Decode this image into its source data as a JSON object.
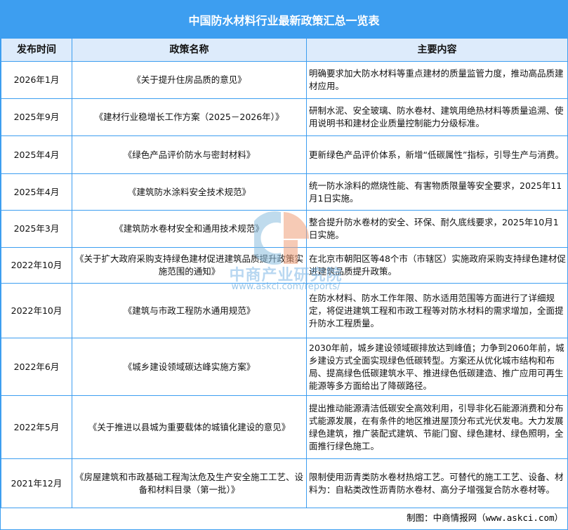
{
  "title": "中国防水材料行业最新政策汇总一览表",
  "headers": [
    "发布时间",
    "政策名称",
    "主要内容"
  ],
  "rows": [
    {
      "date": "2026年1月",
      "name": "《关于提升住房品质的意见》",
      "content": "明确要求加大防水材料等重点建材的质量监管力度，推动高品质建材应用。"
    },
    {
      "date": "2025年9月",
      "name": "《建材行业稳增长工作方案（2025－2026年）》",
      "content": "研制水泥、安全玻璃、防水卷材、建筑用绝热材料等质量追溯、使用说明书和建材企业质量控制能力分级标准。"
    },
    {
      "date": "2025年4月",
      "name": "《绿色产品评价防水与密封材料》",
      "content": "更新绿色产品评价体系，新增“低碳属性”指标，引导生产与消费。"
    },
    {
      "date": "2025年4月",
      "name": "《建筑防水涂料安全技术规范》",
      "content": "统一防水涂料的燃烧性能、有害物质限量等安全要求，2025年11月1日实施。"
    },
    {
      "date": "2025年3月",
      "name": "《建筑防水卷材安全和通用技术规范》",
      "content": "整合提升防水卷材的安全、环保、耐久底线要求，2025年10月1日实施。"
    },
    {
      "date": "2022年10月",
      "name": "《关于扩大政府采购支持绿色建材促进建筑品质提升政策实施范围的通知》",
      "content": "在北京市朝阳区等48个市（市辖区）实施政府采购支持绿色建材促进建筑品质提升政策。"
    },
    {
      "date": "2022年10月",
      "name": "《建筑与市政工程防水通用规范》",
      "content": "在防水材料、防水工作年限、防水适用范围等方面进行了详细规定，将促进建筑工程和市政工程等对防水材料的需求增加，全面提升防水工程质量。"
    },
    {
      "date": "2022年6月",
      "name": "《城乡建设领域碳达峰实施方案》",
      "content": "2030年前，城乡建设领域碳排放达到峰值；力争到2060年前，城乡建设方式全面实现绿色低碳转型。方案还从优化城市结构和布局、提高绿色低碳建筑水平、推进绿色低碳建造、推广应用可再生能源等多方面给出了降碳路径。"
    },
    {
      "date": "2022年5月",
      "name": "《关于推进以县城为重要载体的城镇化建设的意见》",
      "content": "提出推动能源清洁低碳安全高效利用，引导非化石能源消费和分布式能源发展，在有条件的地区推进屋顶分布式光伏发电。大力发展绿色建筑，推广装配式建筑、节能门窗、绿色建材、绿色照明，全面推行绿色施工。"
    },
    {
      "date": "2021年12月",
      "name": "《房屋建筑和市政基础工程淘汰危及生产安全施工工艺、设备和材料目录（第一批）》",
      "content": "限制使用沥青类防水卷材热熔工艺。可替代的施工工艺、设备、材料为：自粘类改性沥青防水卷材、高分子增强复合防水卷材等。"
    }
  ],
  "footer": "制图：中商情报网（www.askci.com）",
  "watermark": {
    "name": "中商产业研究院",
    "url": "www.askci.com/reports/"
  }
}
